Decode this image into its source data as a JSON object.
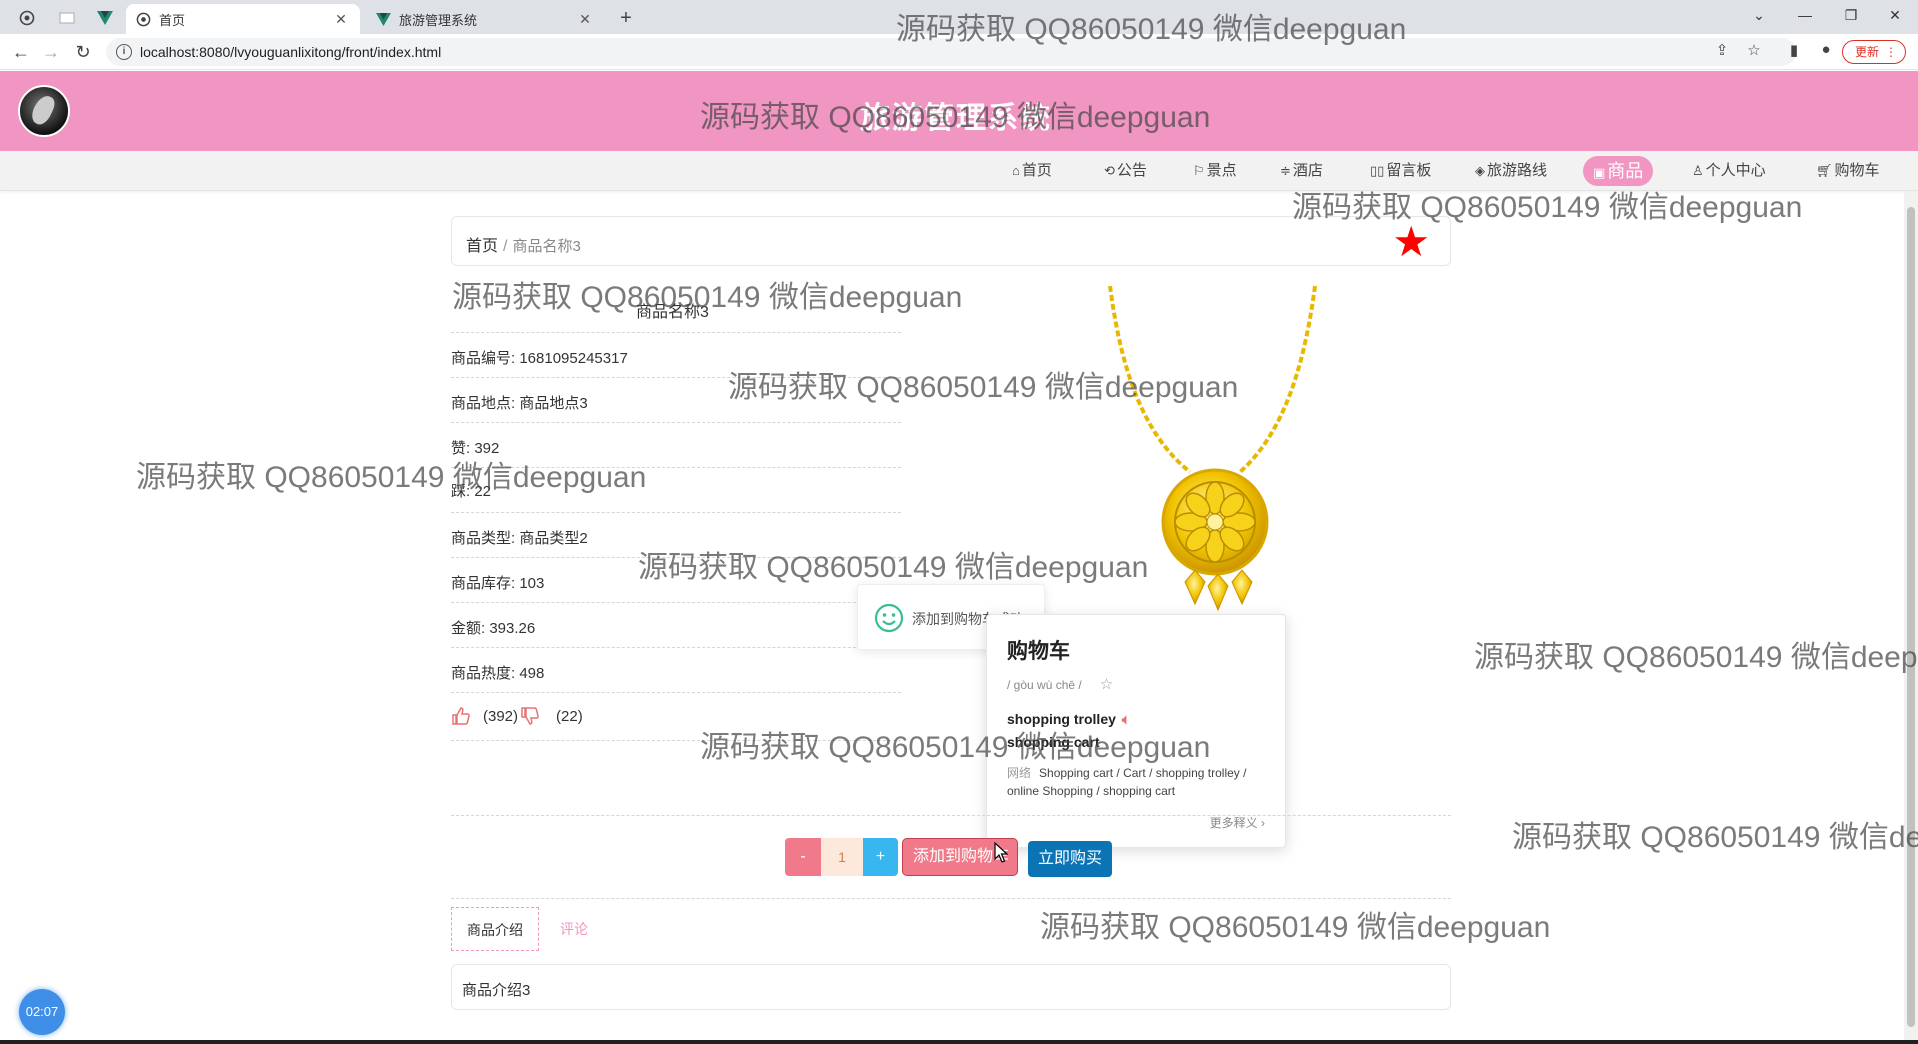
{
  "browser": {
    "tabs": [
      {
        "title": "首页",
        "active": true
      },
      {
        "title": "旅游管理系统",
        "active": false
      }
    ],
    "url": "localhost:8080/lvyouguanlixitong/front/index.html",
    "update_label": "更新"
  },
  "site": {
    "title": "旅游管理系统",
    "nav": [
      {
        "label": "首页",
        "icon": "home-icon"
      },
      {
        "label": "公告",
        "icon": "announcement-icon"
      },
      {
        "label": "景点",
        "icon": "flag-icon"
      },
      {
        "label": "酒店",
        "icon": "hotel-icon"
      },
      {
        "label": "留言板",
        "icon": "message-icon"
      },
      {
        "label": "旅游路线",
        "icon": "route-icon"
      },
      {
        "label": "商品",
        "icon": "goods-icon",
        "active": true
      },
      {
        "label": "个人中心",
        "icon": "user-icon"
      },
      {
        "label": "购物车",
        "icon": "cart-icon"
      }
    ]
  },
  "breadcrumb": {
    "home": "首页",
    "separator": "/",
    "current": "商品名称3"
  },
  "product": {
    "name": "商品名称3",
    "fields": [
      "商品编号: 1681095245317",
      "商品地点: 商品地点3",
      "赞: 392",
      "踩: 22",
      "商品类型: 商品类型2",
      "商品库存: 103",
      "金额: 393.26",
      "商品热度: 498"
    ],
    "likes": "(392)",
    "dislikes": "(22)",
    "quantity": "1",
    "minus_label": "-",
    "plus_label": "+",
    "add_cart_label": "添加到购物车",
    "buy_label": "立即购买",
    "tabs": {
      "intro": "商品介绍",
      "comment": "评论"
    },
    "description": "商品介绍3"
  },
  "toast": {
    "message": "添加到购物车成功"
  },
  "dictionary": {
    "word": "购物车",
    "pinyin": "/ gòu wù chē /",
    "def1": "shopping trolley",
    "def2": "shopping cart",
    "web_label": "网络",
    "web_defs": "Shopping cart / Cart / shopping trolley / online Shopping / shopping cart",
    "more": "更多释义 ›"
  },
  "watermark": "源码获取 QQ86050149 微信deepguan",
  "clock": "02:07",
  "colors": {
    "brand_pink": "#f196c2",
    "star_red": "#ff0000",
    "buy_blue": "#0b74b5"
  }
}
